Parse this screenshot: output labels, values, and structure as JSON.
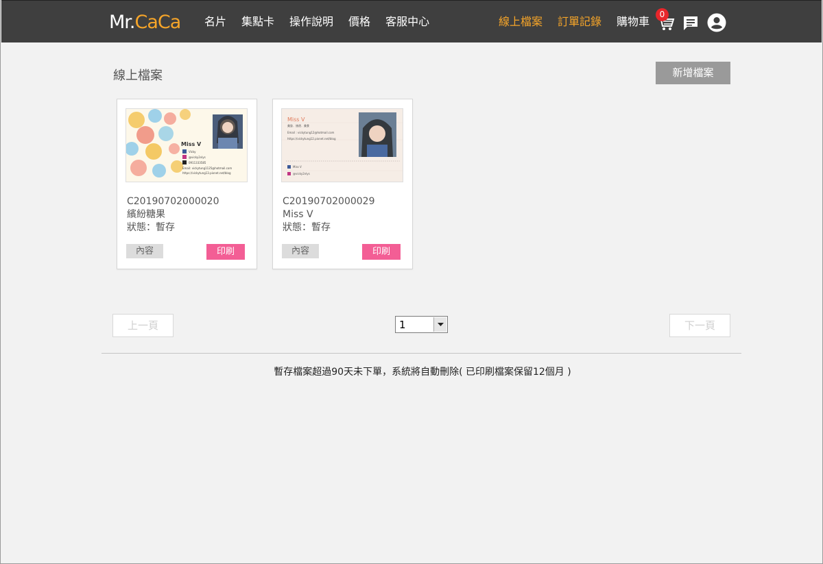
{
  "header": {
    "logo_mr": "Mr.",
    "logo_caca": "CaCa",
    "nav_left": [
      "名片",
      "集點卡",
      "操作說明",
      "價格",
      "客服中心"
    ],
    "nav_right": [
      "線上檔案",
      "訂單記錄",
      "購物車"
    ],
    "cart_count": "0",
    "icons": [
      "cart-icon",
      "message-icon",
      "account-icon"
    ],
    "colors": {
      "bar": "#3f3f3f",
      "accent": "#f6a529",
      "badge": "#e8262b"
    }
  },
  "main": {
    "title": "線上檔案",
    "new_button": "新增檔案",
    "cards": [
      {
        "code": "C20190702000020",
        "name": "繽紛糖果",
        "status": "狀態：暫存",
        "content_button": "內容",
        "print_button": "印刷",
        "preview": {
          "name": "Miss V",
          "lines": [
            "Vicky",
            "@vicky2vlys",
            "0911333585",
            "Email: vickytung1125@hotmail.com",
            "https://vickytung13.pixnet.net/blog"
          ]
        }
      },
      {
        "code": "C20190702000029",
        "name": "Miss V",
        "status": "狀態：暫存",
        "content_button": "內容",
        "print_button": "印刷",
        "preview": {
          "name": "Miss V",
          "lines": [
            "美妝．旅遊．美食",
            "Email : vickytung12@hotmail.com",
            "https://vickytung12.pixnet.net/blog",
            "Miss V",
            "@vicky2vlys"
          ]
        }
      }
    ],
    "pagination": {
      "prev": "上一頁",
      "next": "下一頁",
      "current": "1"
    },
    "notice": "暫存檔案超過90天未下單，系統將自動刪除( 已印刷檔案保留12個月 )",
    "colors": {
      "print": "#f35e95",
      "new_button": "#9a9a9a"
    }
  }
}
